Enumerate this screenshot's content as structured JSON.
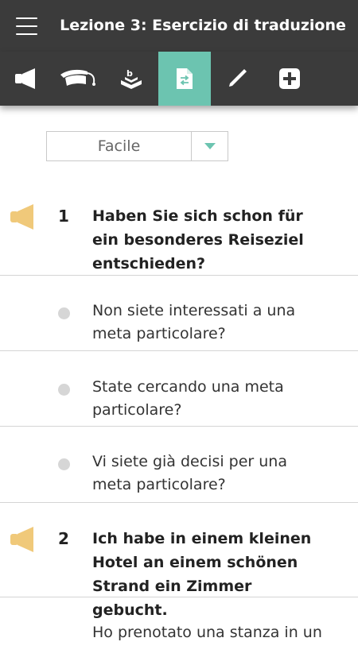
{
  "header": {
    "title": "Lezione 3: Esercizio di traduzione"
  },
  "toolbar": {
    "tools": [
      {
        "icon": "megaphone-icon"
      },
      {
        "icon": "graduation-cap-icon"
      },
      {
        "icon": "book-stand-icon"
      },
      {
        "icon": "translate-document-icon",
        "active": true
      },
      {
        "icon": "pen-icon"
      },
      {
        "icon": "plus-icon"
      }
    ],
    "active_color": "#6cc4b0"
  },
  "level": {
    "selected": "Facile"
  },
  "questions": [
    {
      "number": "1",
      "text": "Haben Sie sich schon für ein besonderes Reiseziel entschieden?",
      "options": [
        "Non siete interessati a una meta particolare?",
        "State cercando una meta particolare?",
        "Vi siete già decisi per una meta particolare?"
      ]
    },
    {
      "number": "2",
      "text": "Ich habe in einem kleinen Hotel an einem schönen Strand ein Zimmer gebucht.",
      "options": [
        "Ho prenotato una stanza in un"
      ]
    }
  ],
  "colors": {
    "bar": "#3b3b3b",
    "accent": "#6cc4b0",
    "speaker": "#f0c97a"
  }
}
